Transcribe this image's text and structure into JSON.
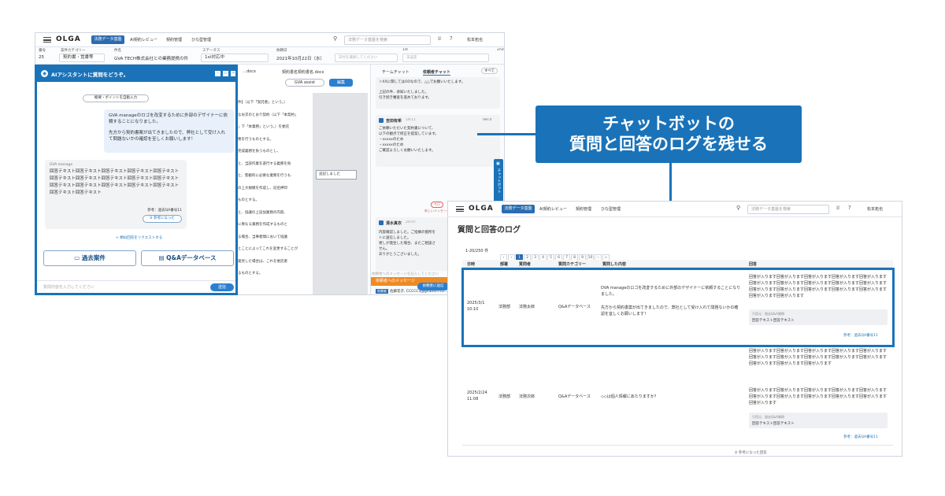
{
  "app": {
    "logo": "OLGA",
    "nav": [
      "法務データ基盤",
      "AI契約レビュー",
      "契約管理",
      "ひな型管理"
    ],
    "search_placeholder": "法務データ基盤を検索",
    "user": "松本拓也"
  },
  "case": {
    "labels": [
      "番号",
      "案件カテゴリー",
      "件名",
      "ステータス",
      "依頼日",
      "1st",
      "2nd"
    ],
    "no": "25",
    "category": "契約書・覚書等",
    "title": "GVA TECH株式会社との業務提携の件",
    "status": "1st対応中",
    "date": "2021年10月22日（水）",
    "due_placeholder": "日付を選択してください",
    "assignee": "未設定"
  },
  "doc": {
    "tab1": "…docx",
    "tab2": "契約書名契約書名.docx",
    "assist_btn": "GVA assist",
    "edit_btn": "編集",
    "comment": "追記しました",
    "lines": [
      "件】（以下「受託者」という。）",
      "なお次のとおり契約（以下「本契約」",
      "」下「本業務」という。）を委託",
      "務を行うものとする。",
      "完成義務を負うものとし、",
      "と、当該作業を遂行する義務を負",
      "と、客観的に必要な業務を行うも",
      "の上大規模を作成し、記名押印",
      "ものとする。",
      "と、協議の上追加業務の内容、",
      "に異なる業務を作成するものと",
      "る場合、当事者間において協議",
      "とことによってこれを変更することが",
      "発見した場合は、これを委託者",
      "るものとする。"
    ]
  },
  "rightpane": {
    "tabs": [
      "チームチャット",
      "依頼者チャット"
    ],
    "all": "すべて",
    "msg0": [
      "＞XXに関してはOOなので、△△でお願いいたします。",
      "上記の件、承知いたしました。",
      "引き続き審査を進めております。"
    ],
    "user1": "吉田有希",
    "time1": "19:11",
    "ver1": "Ver.4",
    "msg1": [
      "ご依頼いただいた契約書について、",
      "以下の観点で修正を提案しています。",
      "・xxxxxのため",
      "・xxxxxのため",
      "ご確認よろしくお願いいたします。"
    ],
    "today": "今日",
    "newmsg": "新しいメッセージ",
    "user2": "清水真衣",
    "time2": "20:47",
    "ver2": "Ver.4",
    "msg2": [
      "内容確認しました。ご指摘の箇所を",
      "トに送信しました。",
      "更しが発生した場合、またご相談さ",
      "せん。",
      "ありがとうございました。"
    ],
    "requester_label": "依頼者へのメッセージ",
    "requester_tag": "依頼者",
    "requester": "佐藤花子, CCCCC1@gvatech.co…",
    "input_placeholder": "依頼者へのメッセージを記入してください",
    "send": "依頼者に送信",
    "side_tab": "チャットボット"
  },
  "chat": {
    "title": "AIアシスタントに質問をどうぞ。",
    "autofill": "概要・ポイントを自動入力",
    "user_msg1": "GVA manageのロゴを改変するために外部のデザイナーに依頼することになりました。",
    "user_msg2": "先方から契約書案が出てきましたので、弊社として受け入れて問題ないかの確認を至しくお願いします！",
    "bot_name": "GVA manage",
    "bot_msg": "回答テキスト回答テキスト回答テキスト回答テキスト回答テキスト回答テキスト回答テキスト回答テキスト回答テキスト回答テキスト回答テキスト回答テキスト回答テキスト回答テキスト回答テキスト回答テキスト回答テキスト",
    "ref": "参考：過去QA番号11",
    "helpful": "参考になった",
    "request": "類似回答をリクエストする",
    "btn_past": "過去案件",
    "btn_qa": "Q&Aデータベース",
    "input_placeholder": "質問内容を入力してください",
    "send": "送信"
  },
  "callout": {
    "line1": "チャットボットの",
    "line2": "質問と回答のログを残せる"
  },
  "log": {
    "title": "質問と回答のログ",
    "count": "1-20/250 件",
    "pages": [
      "‹",
      "‹",
      "1",
      "2",
      "3",
      "4",
      "5",
      "6",
      "7",
      "8",
      "9",
      "10",
      "›",
      "»"
    ],
    "headers": [
      "日時",
      "部署",
      "質問者",
      "質問カテゴリー",
      "質問した内容",
      "回答"
    ],
    "rows": [
      {
        "date": "2025/3/1",
        "time": "10:10",
        "dept": "法務部",
        "user": "法務太郎",
        "cat": "Q&Aデータベース",
        "q1": "DVA manageのロゴを改変するために外部のデザイナーに依頼することになりました。",
        "q2": "先方から契約書案が出てきましたので、弊社として受け入れて問題ないかの確認を宜しくお願いします！",
        "answer": "回答が入ります回答が入ります回答が入ります回答が入ります回答が入ります回答が入ります回答が入ります回答が入ります回答が入ります回答が入ります回答が入ります回答が入ります回答が入ります回答が入ります回答が入ります回答が入ります回答が入ります",
        "ref_label": "引用元：過去Q&A質問",
        "ref_text": "回答テキスト回答テキスト",
        "ref_link": "参考：過去QA番号11"
      },
      {
        "date": "2025/2/24",
        "time": "11:08",
        "dept": "法務部",
        "user": "法務次郎",
        "cat": "Q&Aデータベース",
        "q1": "◇◇は個人情報にあたりますか？",
        "q2": "",
        "answer": "回答が入ります回答が入ります回答が入ります回答が入ります回答が入ります回答が入ります回答が入ります回答が入ります回答が入ります回答が入ります回答が入ります回答が入ります回答が入ります",
        "answer2": "回答が入ります回答が入ります回答が入ります回答が入ります回答が入ります回答が入ります回答が入ります回答が入ります回答が入ります回答が入ります回答が入ります",
        "ref_label": "引用元：過去Q&A質問",
        "ref_text": "回答テキスト回答テキスト",
        "ref_link": "参考：過去QA番号11"
      }
    ],
    "helpful_footer": "参考になった回答"
  }
}
